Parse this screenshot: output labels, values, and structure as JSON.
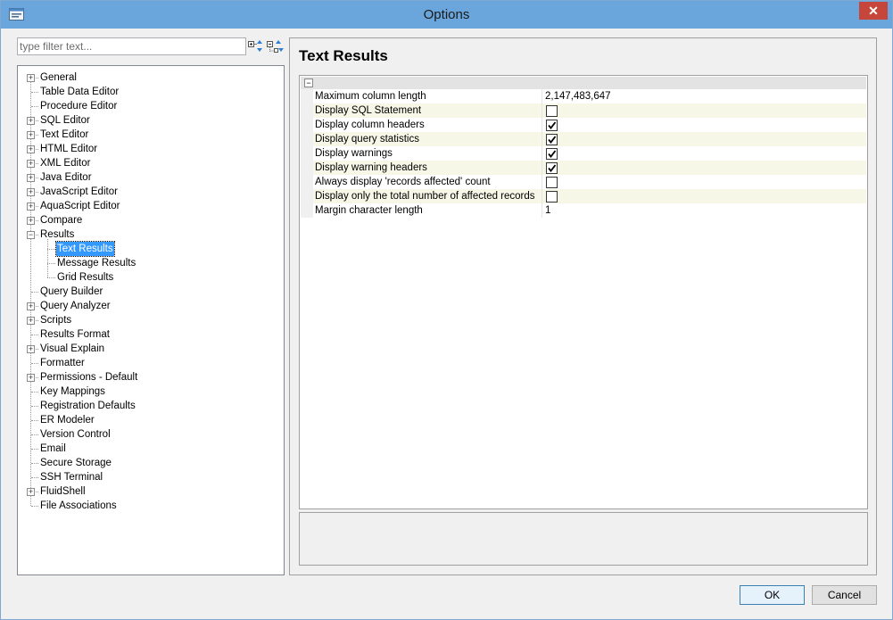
{
  "window": {
    "title": "Options"
  },
  "filter": {
    "placeholder": "type filter text..."
  },
  "icons": {
    "app": "options-app-icon",
    "expand_all": "expand-all-icon",
    "collapse_all": "collapse-all-icon",
    "close": "close-icon"
  },
  "tree": [
    {
      "label": "General",
      "expandable": true
    },
    {
      "label": "Table Data Editor",
      "expandable": false
    },
    {
      "label": "Procedure Editor",
      "expandable": false
    },
    {
      "label": "SQL Editor",
      "expandable": true
    },
    {
      "label": "Text Editor",
      "expandable": true
    },
    {
      "label": "HTML Editor",
      "expandable": true
    },
    {
      "label": "XML Editor",
      "expandable": true
    },
    {
      "label": "Java Editor",
      "expandable": true
    },
    {
      "label": "JavaScript Editor",
      "expandable": true
    },
    {
      "label": "AquaScript Editor",
      "expandable": true
    },
    {
      "label": "Compare",
      "expandable": true
    },
    {
      "label": "Results",
      "expandable": true,
      "expanded": true
    },
    {
      "label": "Text Results",
      "child": true,
      "selected": true
    },
    {
      "label": "Message Results",
      "child": true
    },
    {
      "label": "Grid Results",
      "child": true
    },
    {
      "label": "Query Builder",
      "expandable": false
    },
    {
      "label": "Query Analyzer",
      "expandable": true
    },
    {
      "label": "Scripts",
      "expandable": true
    },
    {
      "label": "Results Format",
      "expandable": false
    },
    {
      "label": "Visual Explain",
      "expandable": true
    },
    {
      "label": "Formatter",
      "expandable": false
    },
    {
      "label": "Permissions - Default",
      "expandable": true
    },
    {
      "label": "Key Mappings",
      "expandable": false
    },
    {
      "label": "Registration Defaults",
      "expandable": false
    },
    {
      "label": "ER Modeler",
      "expandable": false
    },
    {
      "label": "Version Control",
      "expandable": false
    },
    {
      "label": "Email",
      "expandable": false
    },
    {
      "label": "Secure Storage",
      "expandable": false
    },
    {
      "label": "SSH Terminal",
      "expandable": false
    },
    {
      "label": "FluidShell",
      "expandable": true
    },
    {
      "label": "File Associations",
      "expandable": false
    }
  ],
  "page": {
    "title": "Text Results"
  },
  "properties": [
    {
      "name": "Maximum column length",
      "type": "text",
      "value": "2,147,483,647"
    },
    {
      "name": "Display SQL Statement",
      "type": "checkbox",
      "checked": false
    },
    {
      "name": "Display column headers",
      "type": "checkbox",
      "checked": true
    },
    {
      "name": "Display query statistics",
      "type": "checkbox",
      "checked": true
    },
    {
      "name": "Display warnings",
      "type": "checkbox",
      "checked": true
    },
    {
      "name": "Display warning headers",
      "type": "checkbox",
      "checked": true
    },
    {
      "name": "Always display 'records affected' count",
      "type": "checkbox",
      "checked": false
    },
    {
      "name": "Display only the total number of affected records",
      "type": "checkbox",
      "checked": false
    },
    {
      "name": "Margin character length",
      "type": "text",
      "value": "1"
    }
  ],
  "buttons": {
    "ok": "OK",
    "cancel": "Cancel"
  }
}
